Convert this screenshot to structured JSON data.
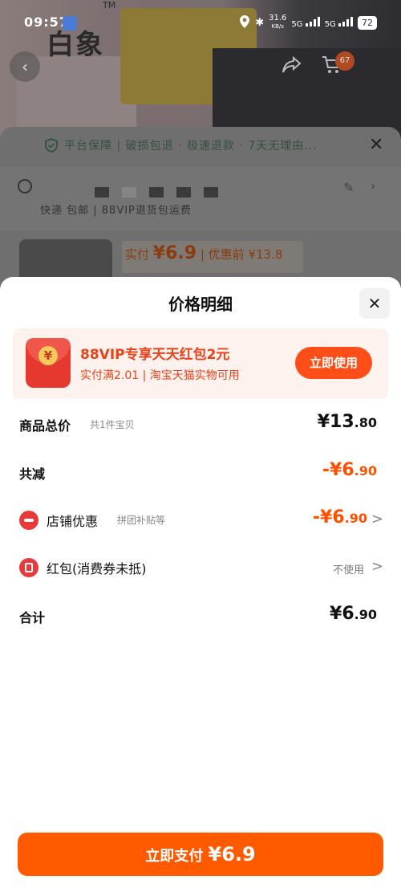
{
  "status_bar": {
    "time": "09:57",
    "net_speed_value": "31.6",
    "net_speed_unit": "KB/s",
    "sig1": "5G",
    "sig2": "5G",
    "battery": "72"
  },
  "background": {
    "brand_logo": "白象",
    "brand_tm": "TM",
    "cart_count": "67",
    "guarantee_text": "平台保障 | 破损包退 · 极速退款 · 7天无理由...",
    "shipping_text": "快递 包邮 | 88VIP退货包运费",
    "price_prefix": "实付",
    "price_value": "¥6.9",
    "price_suffix": "| 优惠前 ¥13.8"
  },
  "modal": {
    "title": "价格明细",
    "promo": {
      "title": "88VIP专享天天红包2元",
      "subtitle": "实付满2.01 | 淘宝天猫实物可用",
      "button": "立即使用",
      "coin": "¥"
    },
    "rows": {
      "total": {
        "label": "商品总价",
        "sub": "共1件宝贝",
        "value_main": "¥13",
        "value_dec": ".80"
      },
      "reduce": {
        "label": "共减",
        "value_main": "-¥6",
        "value_dec": ".90"
      },
      "shop_discount": {
        "label": "店铺优惠",
        "sub": "拼团补贴等",
        "value_main": "-¥6",
        "value_dec": ".90",
        "arrow": ">"
      },
      "red_packet": {
        "label": "红包(消费券未抵)",
        "value": "不使用",
        "arrow": ">"
      },
      "sum": {
        "label": "合计",
        "value_main": "¥6",
        "value_dec": ".90"
      }
    },
    "pay_button": {
      "label": "立即支付",
      "amount": "¥6.9"
    }
  },
  "colors": {
    "accent": "#ff5000",
    "promo_bg": "#fdf2ee",
    "button": "#ff5a00"
  },
  "icons": [
    "close-icon",
    "location-pin-icon",
    "edit-icon",
    "chevron-right-icon",
    "shield-icon",
    "red-packet-icon",
    "shop-discount-icon",
    "coupon-icon",
    "back-arrow-icon",
    "share-icon",
    "cart-icon"
  ]
}
